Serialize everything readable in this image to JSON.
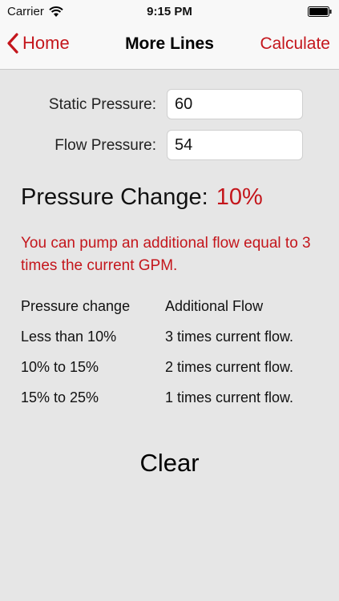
{
  "status_bar": {
    "carrier": "Carrier",
    "time": "9:15 PM"
  },
  "nav": {
    "back_label": "Home",
    "title": "More Lines",
    "action_label": "Calculate"
  },
  "form": {
    "static_label": "Static Pressure:",
    "static_value": "60",
    "flow_label": "Flow Pressure:",
    "flow_value": "54"
  },
  "result": {
    "label": "Pressure Change:",
    "value": "10%",
    "message": "You can pump an additional flow equal to 3 times the current GPM."
  },
  "table": {
    "headers": [
      "Pressure change",
      "Additional Flow"
    ],
    "rows": [
      [
        "Less than 10%",
        "3 times current flow."
      ],
      [
        "10% to 15%",
        "2 times current flow."
      ],
      [
        "15% to 25%",
        "1 times current flow."
      ]
    ]
  },
  "clear_label": "Clear",
  "colors": {
    "accent": "#c4161c",
    "background": "#e6e6e6",
    "bar": "#f8f8f8"
  },
  "icons": {
    "wifi": "wifi-icon",
    "battery": "battery-icon",
    "back": "chevron-left-icon"
  }
}
